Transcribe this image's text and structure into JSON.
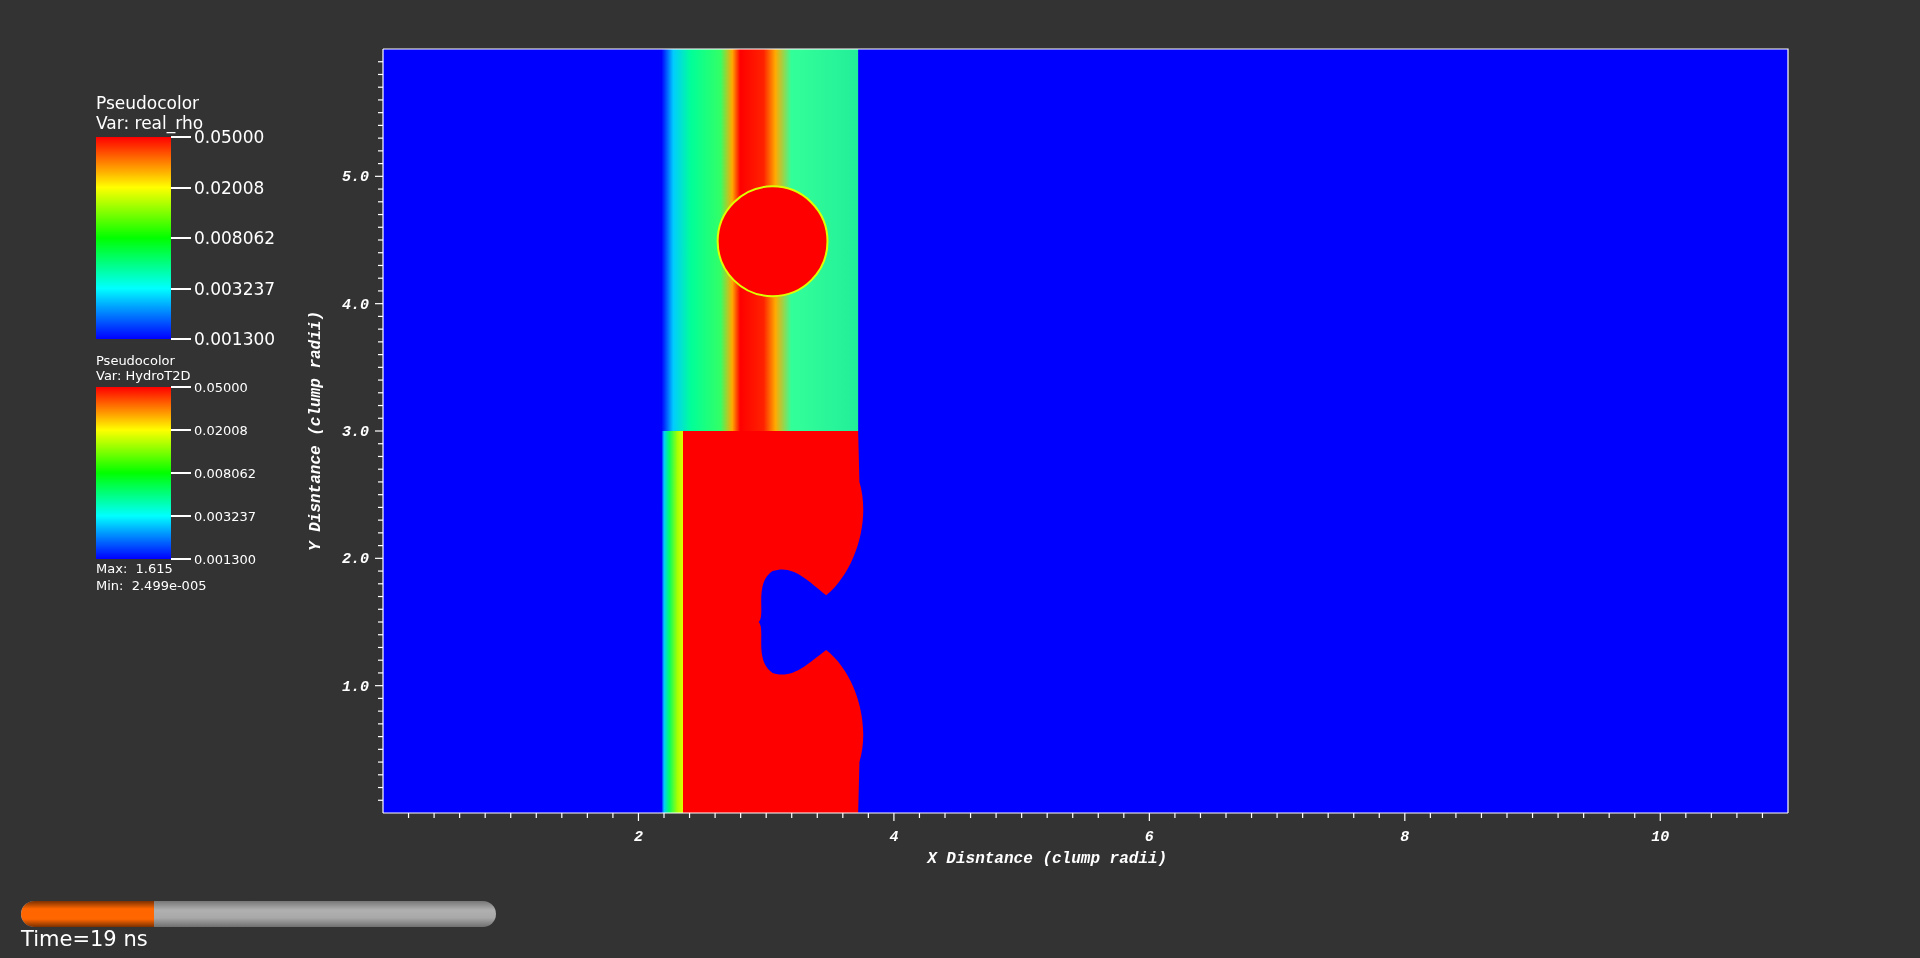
{
  "legends": [
    {
      "kind": "large",
      "title": "Pseudocolor",
      "variable": "Var: real_rho",
      "labels": [
        "0.05000",
        "0.02008",
        "0.008062",
        "0.003237",
        "0.001300"
      ]
    },
    {
      "kind": "small",
      "title": "Pseudocolor",
      "variable": "Var: HydroT2D",
      "labels": [
        "0.05000",
        "0.02008",
        "0.008062",
        "0.003237",
        "0.001300"
      ],
      "max": "Max:  1.615",
      "min": "Min:  2.499e-005"
    }
  ],
  "plot": {
    "x_axis": {
      "title": "X Disntance (clump radii)",
      "tick_labels": [
        "2",
        "4",
        "6",
        "8",
        "10"
      ]
    },
    "y_axis": {
      "title": "Y Disntance (clump radii)",
      "tick_labels": [
        "5.0",
        "4.0",
        "3.0",
        "2.0",
        "1.0"
      ]
    }
  },
  "time_slider": {
    "level": 0.28,
    "label": "Time=19 ns"
  }
}
